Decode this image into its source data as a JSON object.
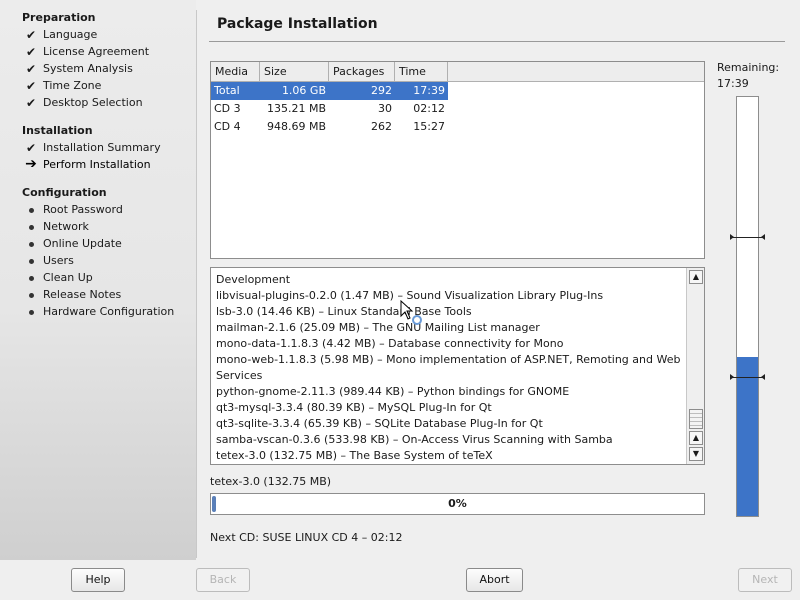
{
  "sidebar": {
    "sections": [
      {
        "title": "Preparation",
        "items": [
          {
            "label": "Language",
            "state": "done"
          },
          {
            "label": "License Agreement",
            "state": "done"
          },
          {
            "label": "System Analysis",
            "state": "done"
          },
          {
            "label": "Time Zone",
            "state": "done"
          },
          {
            "label": "Desktop Selection",
            "state": "done"
          }
        ]
      },
      {
        "title": "Installation",
        "items": [
          {
            "label": "Installation Summary",
            "state": "done"
          },
          {
            "label": "Perform Installation",
            "state": "current"
          }
        ]
      },
      {
        "title": "Configuration",
        "items": [
          {
            "label": "Root Password",
            "state": "pending"
          },
          {
            "label": "Network",
            "state": "pending"
          },
          {
            "label": "Online Update",
            "state": "pending"
          },
          {
            "label": "Users",
            "state": "pending"
          },
          {
            "label": "Clean Up",
            "state": "pending"
          },
          {
            "label": "Release Notes",
            "state": "pending"
          },
          {
            "label": "Hardware Configuration",
            "state": "pending"
          }
        ]
      }
    ]
  },
  "main": {
    "title": "Package Installation",
    "table": {
      "headers": [
        "Media",
        "Size",
        "Packages",
        "Time"
      ],
      "rows": [
        {
          "media": "Total",
          "size": "1.06 GB",
          "packages": "292",
          "time": "17:39",
          "selected": true
        },
        {
          "media": "CD 3",
          "size": "135.21 MB",
          "packages": "30",
          "time": "02:12",
          "selected": false
        },
        {
          "media": "CD 4",
          "size": "948.69 MB",
          "packages": "262",
          "time": "15:27",
          "selected": false
        }
      ]
    },
    "log": [
      "Development",
      "libvisual-plugins-0.2.0 (1.47 MB) – Sound Visualization Library Plug-Ins",
      "lsb-3.0 (14.46 KB) – Linux Standard Base Tools",
      "mailman-2.1.6 (25.09 MB) – The GNU Mailing List manager",
      "mono-data-1.1.8.3 (4.42 MB) – Database connectivity for Mono",
      "mono-web-1.1.8.3 (5.98 MB) – Mono implementation of ASP.NET, Remoting and Web Services",
      "python-gnome-2.11.3 (989.44 KB) – Python bindings for GNOME",
      "qt3-mysql-3.3.4 (80.39 KB) – MySQL Plug-In for Qt",
      "qt3-sqlite-3.3.4 (65.39 KB) – SQLite Database Plug-In for Qt",
      "samba-vscan-0.3.6 (533.98 KB) – On-Access Virus Scanning with Samba",
      "tetex-3.0 (132.75 MB) – The Base System of teTeX"
    ],
    "current_package": "tetex-3.0 (132.75 MB)",
    "progress": {
      "label": "0%",
      "value": 0
    },
    "next_cd": "Next CD: SUSE LINUX CD 4 – 02:12",
    "remaining": {
      "label": "Remaining:",
      "time": "17:39",
      "fraction_filled": 0.38
    }
  },
  "buttons": {
    "help": "Help",
    "back": "Back",
    "abort": "Abort",
    "next": "Next"
  },
  "icons": {
    "done": "check-icon",
    "current": "arrow-right-icon",
    "pending": "bullet-icon"
  },
  "colors": {
    "selection": "#3d74c8",
    "gauge": "#3d74c8"
  }
}
